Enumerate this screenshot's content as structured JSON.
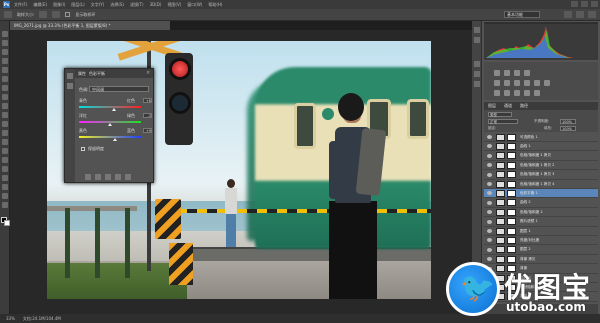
{
  "menubar": {
    "logo": "Ps",
    "items": [
      "文件(F)",
      "编辑(E)",
      "图像(I)",
      "图层(L)",
      "文字(Y)",
      "选择(S)",
      "滤镜(T)",
      "3D(D)",
      "视图(V)",
      "窗口(W)",
      "帮助(H)"
    ]
  },
  "optionsbar": {
    "sample_label": "取样大小:",
    "sample_value": "取样点",
    "show_ring_label": "显示取样环",
    "workspace_value": "基本功能"
  },
  "document": {
    "tab_title": "IMG_2671.jpg @ 33.3% (色彩平衡 1, 图层蒙版/8) *"
  },
  "properties": {
    "tabs": [
      "属性",
      "色彩平衡"
    ],
    "tone_label": "色调:",
    "tone_value": "中间调",
    "sliders": [
      {
        "left": "青色",
        "right": "红色",
        "value": "+8"
      },
      {
        "left": "洋红",
        "right": "绿色",
        "value": "-3"
      },
      {
        "left": "黄色",
        "right": "蓝色",
        "value": "+9"
      }
    ],
    "preserve_label": "保留明度"
  },
  "layers": {
    "tabs": [
      "图层",
      "通道",
      "路径"
    ],
    "kind_value": "类型",
    "blend_value": "正常",
    "opacity_label": "不透明度:",
    "opacity_value": "100%",
    "lock_label": "锁定:",
    "fill_label": "填充:",
    "fill_value": "100%",
    "rows": [
      {
        "name": "可选颜色 1",
        "selected": false
      },
      {
        "name": "曲线 1",
        "selected": false
      },
      {
        "name": "色相/饱和度 1 拷贝",
        "selected": false
      },
      {
        "name": "色相/饱和度 1 拷贝 2",
        "selected": false
      },
      {
        "name": "色相/饱和度 1 拷贝 3",
        "selected": false
      },
      {
        "name": "色相/饱和度 1 拷贝 4",
        "selected": false
      },
      {
        "name": "色彩平衡 1",
        "selected": true
      },
      {
        "name": "曲线 2",
        "selected": false
      },
      {
        "name": "色相/饱和度 2",
        "selected": false
      },
      {
        "name": "照片滤镜 1",
        "selected": false
      },
      {
        "name": "图层 1",
        "selected": false
      },
      {
        "name": "亮度/对比度",
        "selected": false
      },
      {
        "name": "图层 2",
        "selected": false
      },
      {
        "name": "背景 拷贝",
        "selected": false
      },
      {
        "name": "背景",
        "selected": false
      },
      {
        "name": "曲线 3",
        "selected": false
      },
      {
        "name": "自然饱和度",
        "selected": false
      },
      {
        "name": "背景",
        "selected": false
      }
    ]
  },
  "statusbar": {
    "zoom": "33%",
    "doc_info": "文档:24.1M/104.4M"
  },
  "watermark": {
    "chinese": "优图宝",
    "url": "utobao.com"
  },
  "colors": {
    "selection": "#5b86b9",
    "signal_red": "#e02020",
    "train_green": "#2a8a6a",
    "watermark_blue": "#1580e0"
  }
}
